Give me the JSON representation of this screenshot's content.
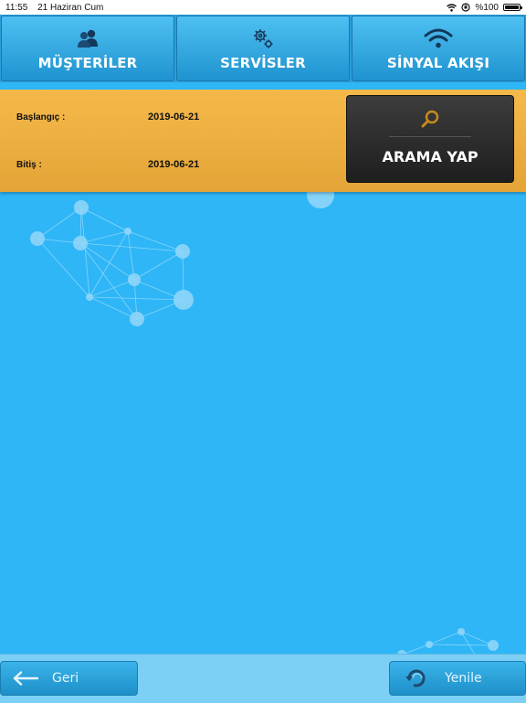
{
  "status_bar": {
    "time": "11:55",
    "date": "21 Haziran Cum",
    "battery": "%100",
    "icons": [
      "wifi-icon",
      "orientation-lock-icon",
      "battery-icon"
    ]
  },
  "nav": {
    "tabs": [
      {
        "label": "MÜŞTERİLER",
        "icon": "users-icon"
      },
      {
        "label": "SERVİSLER",
        "icon": "gears-icon"
      },
      {
        "label": "SİNYAL AKIŞI",
        "icon": "wifi-icon"
      }
    ]
  },
  "search": {
    "start_label": "Başlangıç :",
    "start_value": "2019-06-21",
    "end_label": "Bitiş :",
    "end_value": "2019-06-21",
    "button_label": "ARAMA YAP",
    "button_icon": "search-icon"
  },
  "footer": {
    "back_label": "Geri",
    "back_icon": "arrow-left-icon",
    "refresh_label": "Yenile",
    "refresh_icon": "refresh-icon"
  },
  "colors": {
    "background": "#2fb6f7",
    "panel": "#eeaf40",
    "button_dark": "#2b2b2b",
    "accent_orange": "#c88a1e"
  }
}
